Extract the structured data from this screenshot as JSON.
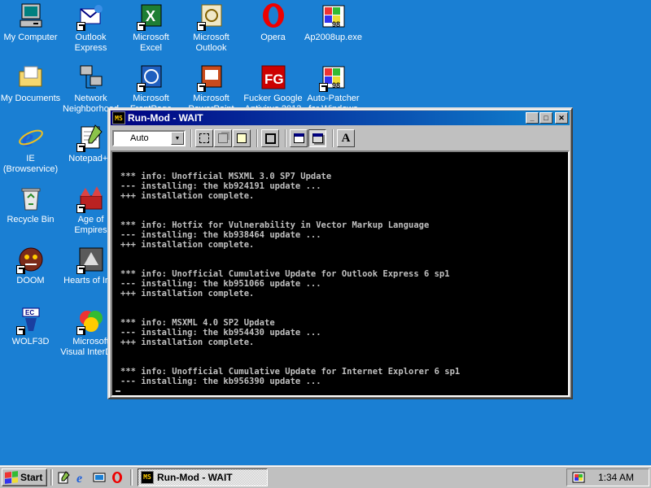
{
  "desktop": {
    "icons": [
      {
        "label1": "My Computer",
        "label2": "",
        "icon": "my-computer-icon"
      },
      {
        "label1": "Outlook",
        "label2": "Express",
        "icon": "outlook-express-icon"
      },
      {
        "label1": "Microsoft",
        "label2": "Excel",
        "icon": "excel-icon"
      },
      {
        "label1": "Microsoft",
        "label2": "Outlook",
        "icon": "outlook-icon"
      },
      {
        "label1": "Opera",
        "label2": "",
        "icon": "opera-icon"
      },
      {
        "label1": "Ap2008up.exe",
        "label2": "",
        "icon": "installer-98-icon"
      },
      {
        "label1": "My Documents",
        "label2": "",
        "icon": "folder-icon"
      },
      {
        "label1": "Network",
        "label2": "Neighborhood",
        "icon": "network-icon"
      },
      {
        "label1": "Microsoft",
        "label2": "FrontPage",
        "icon": "frontpage-icon"
      },
      {
        "label1": "Microsoft",
        "label2": "PowerPoint",
        "icon": "powerpoint-icon"
      },
      {
        "label1": "Fucker Google",
        "label2": "Antivirus 2013",
        "icon": "fg-icon"
      },
      {
        "label1": "Auto-Patcher",
        "label2": "for Windows",
        "icon": "installer-98-icon"
      },
      {
        "label1": "IE",
        "label2": "(Browservice)",
        "icon": "ie-icon"
      },
      {
        "label1": "Notepad++",
        "label2": "",
        "icon": "notepad-icon"
      },
      {
        "label1": "Recycle Bin",
        "label2": "",
        "icon": "recycle-bin-icon"
      },
      {
        "label1": "Age of",
        "label2": "Empires",
        "icon": "age-of-empires-icon"
      },
      {
        "label1": "DOOM",
        "label2": "",
        "icon": "doom-icon"
      },
      {
        "label1": "Hearts of Iron",
        "label2": "",
        "icon": "hearts-of-iron-icon"
      },
      {
        "label1": "WOLF3D",
        "label2": "",
        "icon": "wolf3d-icon"
      },
      {
        "label1": "Microsoft",
        "label2": "Visual InterDev",
        "icon": "visual-interdev-icon"
      }
    ]
  },
  "window": {
    "title": "Run-Mod - WAIT",
    "icon_text": "MS",
    "minimize": "_",
    "maximize": "□",
    "close": "✕",
    "font_select": "Auto",
    "font_button": "A",
    "console_lines": [
      "*** info: Unofficial MSXML 3.0 SP7 Update",
      "--- installing: the kb924191 update ...",
      "+++ installation complete.",
      "",
      "*** info: Hotfix for Vulnerability in Vector Markup Language",
      "--- installing: the kb938464 update ...",
      "+++ installation complete.",
      "",
      "*** info: Unofficial Cumulative Update for Outlook Express 6 sp1",
      "--- installing: the kb951066 update ...",
      "+++ installation complete.",
      "",
      "*** info: MSXML 4.0 SP2 Update",
      "--- installing: the kb954430 update ...",
      "+++ installation complete.",
      "",
      "*** info: Unofficial Cumulative Update for Internet Explorer 6 sp1",
      "--- installing: the kb956390 update ..."
    ]
  },
  "taskbar": {
    "start_label": "Start",
    "task_label": "Run-Mod - WAIT",
    "clock": "1:34 AM"
  },
  "colors": {
    "desktop": "#1a7fd3",
    "titlebar": "#000080",
    "face": "#c0c0c0"
  }
}
